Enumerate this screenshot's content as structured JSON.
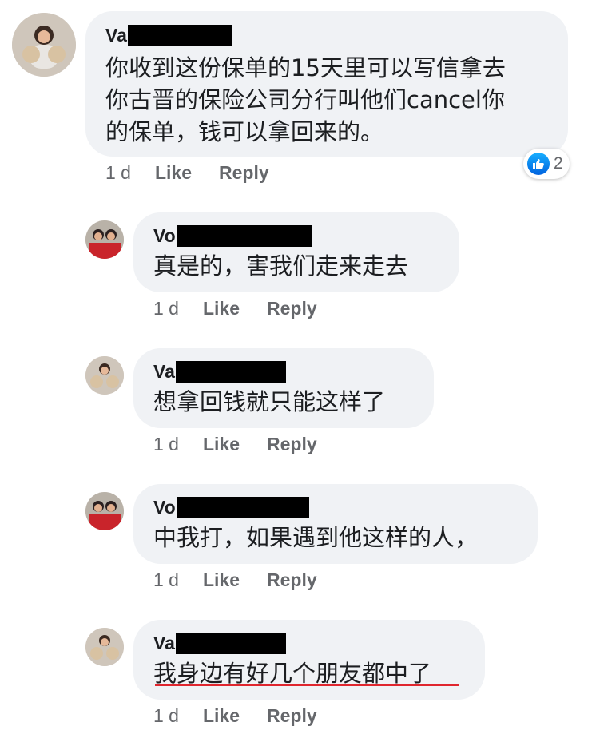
{
  "comments": [
    {
      "name": "Va",
      "text": "你收到这份保单的15天里可以写信拿去\n你古晋的保险公司分行叫他们cancel你\n的保单，钱可以拿回来的。",
      "time": "1 d",
      "like": "Like",
      "reply": "Reply",
      "reaction_count": "2"
    },
    {
      "name": "Vo",
      "text": "真是的，害我们走来走去",
      "time": "1 d",
      "like": "Like",
      "reply": "Reply"
    },
    {
      "name": "Va",
      "text": "想拿回钱就只能这样了",
      "time": "1 d",
      "like": "Like",
      "reply": "Reply"
    },
    {
      "name": "Vo",
      "text": "中我打，如果遇到他这样的人，",
      "time": "1 d",
      "like": "Like",
      "reply": "Reply"
    },
    {
      "name": "Va",
      "text": "我身边有好几个朋友都中了",
      "time": "1 d",
      "like": "Like",
      "reply": "Reply"
    }
  ],
  "colors": {
    "bubble": "#f0f2f5",
    "meta_text": "#65676b",
    "like_blue": "#1877f2",
    "underline": "#e0262e",
    "redaction": "#000000"
  }
}
